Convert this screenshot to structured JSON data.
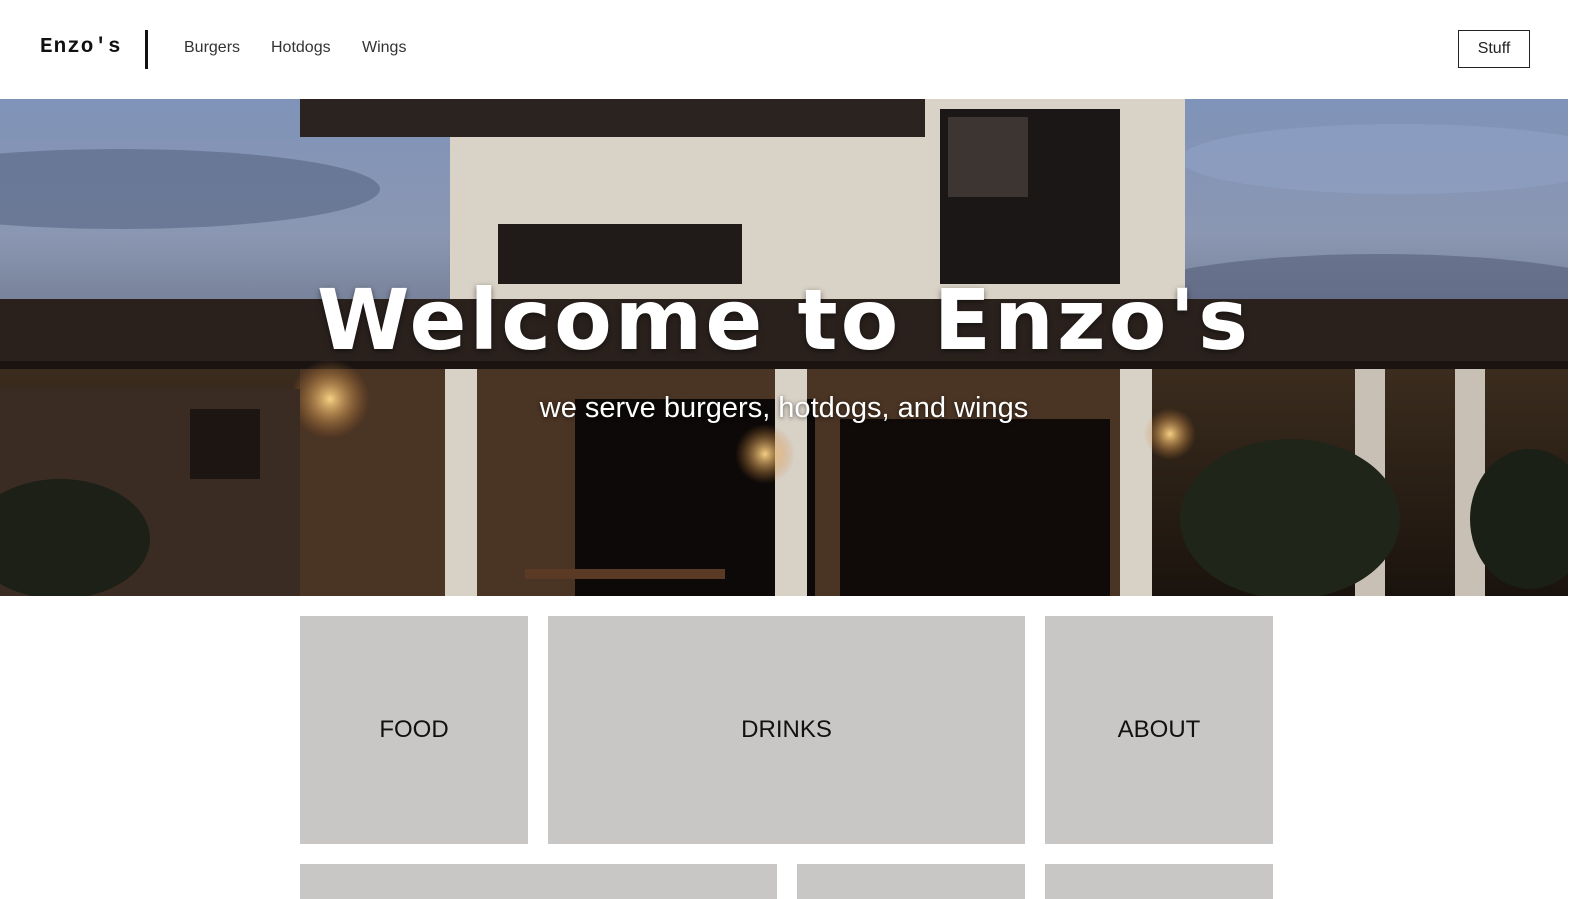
{
  "navbar": {
    "brand": "Enzo's",
    "links": [
      {
        "label": "Burgers"
      },
      {
        "label": "Hotdogs"
      },
      {
        "label": "Wings"
      }
    ],
    "stuff_button": "Stuff"
  },
  "hero": {
    "title": "Welcome to Enzo's",
    "subtitle": "we serve burgers, hotdogs, and wings"
  },
  "tiles": [
    {
      "label": "FOOD"
    },
    {
      "label": "DRINKS"
    },
    {
      "label": "ABOUT"
    },
    {
      "label": ""
    },
    {
      "label": ""
    },
    {
      "label": ""
    }
  ],
  "colors": {
    "tile_background": "#c8c7c5",
    "text": "#111111",
    "page_background": "#ffffff"
  }
}
